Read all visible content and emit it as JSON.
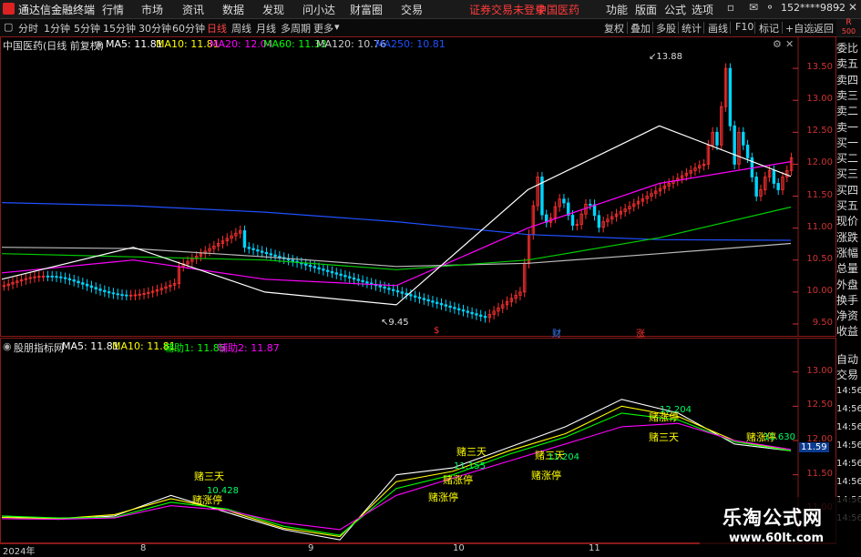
{
  "titlebar": {
    "app_title": "通达信金融终端",
    "menus": [
      "行情",
      "市场",
      "资讯",
      "数据",
      "发现",
      "问小达",
      "财富圈",
      "交易"
    ],
    "broker_status": "证券交易未登录",
    "stock": "中国医药",
    "right_menus": [
      "功能",
      "版面",
      "公式",
      "选项"
    ],
    "account": "152****9892"
  },
  "toolbar": {
    "periods": [
      "分时",
      "1分钟",
      "5分钟",
      "15分钟",
      "30分钟",
      "60分钟",
      "日线",
      "周线",
      "月线",
      "多周期",
      "更多"
    ],
    "active_period": "日线",
    "right_tools": [
      "复权",
      "叠加",
      "多股",
      "统计",
      "画线",
      "F10",
      "标记",
      "+自选",
      "返回"
    ]
  },
  "main_chart": {
    "title": "中国医药(日线 前复权)",
    "legend": [
      {
        "label": "MA5: 11.81",
        "color": "#ffffff"
      },
      {
        "label": "MA10: 11.81",
        "color": "#ffff00"
      },
      {
        "label": "MA20: 12.04",
        "color": "#ff00ff"
      },
      {
        "label": "MA60: 11.33",
        "color": "#00ff00"
      },
      {
        "label": "MA120: 10.76",
        "color": "#cccccc"
      },
      {
        "label": "MA250: 10.81",
        "color": "#2050ff"
      }
    ],
    "y_ticks": [
      "13.50",
      "13.00",
      "12.50",
      "12.00",
      "11.50",
      "11.00",
      "10.50",
      "10.00",
      "9.50"
    ],
    "high_label": "13.88",
    "low_label": "9.45",
    "markers": [
      {
        "text": "$",
        "color": "#ff3030"
      },
      {
        "text": "财",
        "color": "#3a7bff"
      },
      {
        "text": "涨",
        "color": "#ff3030"
      }
    ]
  },
  "sub_chart": {
    "title": "股朋指标网",
    "legend": [
      {
        "label": "MA5: 11.81",
        "color": "#ffffff"
      },
      {
        "label": "MA10: 11.81",
        "color": "#ffff00"
      },
      {
        "label": "辅助1: 11.85",
        "color": "#00ff00"
      },
      {
        "label": "辅助2: 11.87",
        "color": "#ff00ff"
      }
    ],
    "y_ticks": [
      "13.00",
      "12.50",
      "12.00",
      "11.50",
      "11.00"
    ],
    "price_tag": "11.59",
    "annotations_yellow": [
      "赌三天",
      "赌涨停",
      "赌涨停",
      "赌三天",
      "赌涨停",
      "赌三天",
      "赌涨停",
      "赌涨停",
      "赌三天",
      "赌涨停"
    ],
    "annotations_green": [
      "10.428",
      "11.155",
      "11.204",
      "12.204",
      "11.630"
    ]
  },
  "x_axis": [
    "2024年",
    "8",
    "9",
    "10",
    "11"
  ],
  "right_panel": [
    "委比",
    "卖五",
    "卖四",
    "卖三",
    "卖二",
    "卖一",
    "买一",
    "买二",
    "买三",
    "买四",
    "买五",
    "现价",
    "涨跌",
    "涨幅",
    "总量",
    "外盘",
    "换手",
    "净资",
    "收益",
    "自动",
    "交易"
  ],
  "right_times": [
    "14:56",
    "14:56",
    "14:56",
    "14:56",
    "14:56",
    "14:56",
    "14:56",
    "14:56"
  ],
  "r_badge": "R",
  "r_badge_sub": "500",
  "watermark": {
    "title": "乐淘公式网",
    "url": "www.60lt.com"
  },
  "chart_data": {
    "type": "line",
    "title": "中国医药(日线 前复权)",
    "ylim": [
      9.3,
      14.0
    ],
    "x": [
      "2024年",
      "8",
      "9",
      "10",
      "11"
    ],
    "series": [
      {
        "name": "MA250",
        "values": [
          11.4,
          11.35,
          11.25,
          11.1,
          10.9,
          10.82,
          10.81
        ]
      },
      {
        "name": "MA120",
        "values": [
          10.7,
          10.68,
          10.55,
          10.4,
          10.45,
          10.6,
          10.76
        ]
      },
      {
        "name": "MA60",
        "values": [
          10.6,
          10.55,
          10.5,
          10.35,
          10.5,
          10.85,
          11.33
        ]
      },
      {
        "name": "MA20",
        "values": [
          10.3,
          10.5,
          10.2,
          10.1,
          11.0,
          11.7,
          12.04
        ]
      },
      {
        "name": "MA5",
        "values": [
          10.2,
          10.7,
          10.0,
          9.8,
          11.6,
          12.6,
          11.81
        ]
      }
    ],
    "high": 13.88,
    "low": 9.45
  }
}
